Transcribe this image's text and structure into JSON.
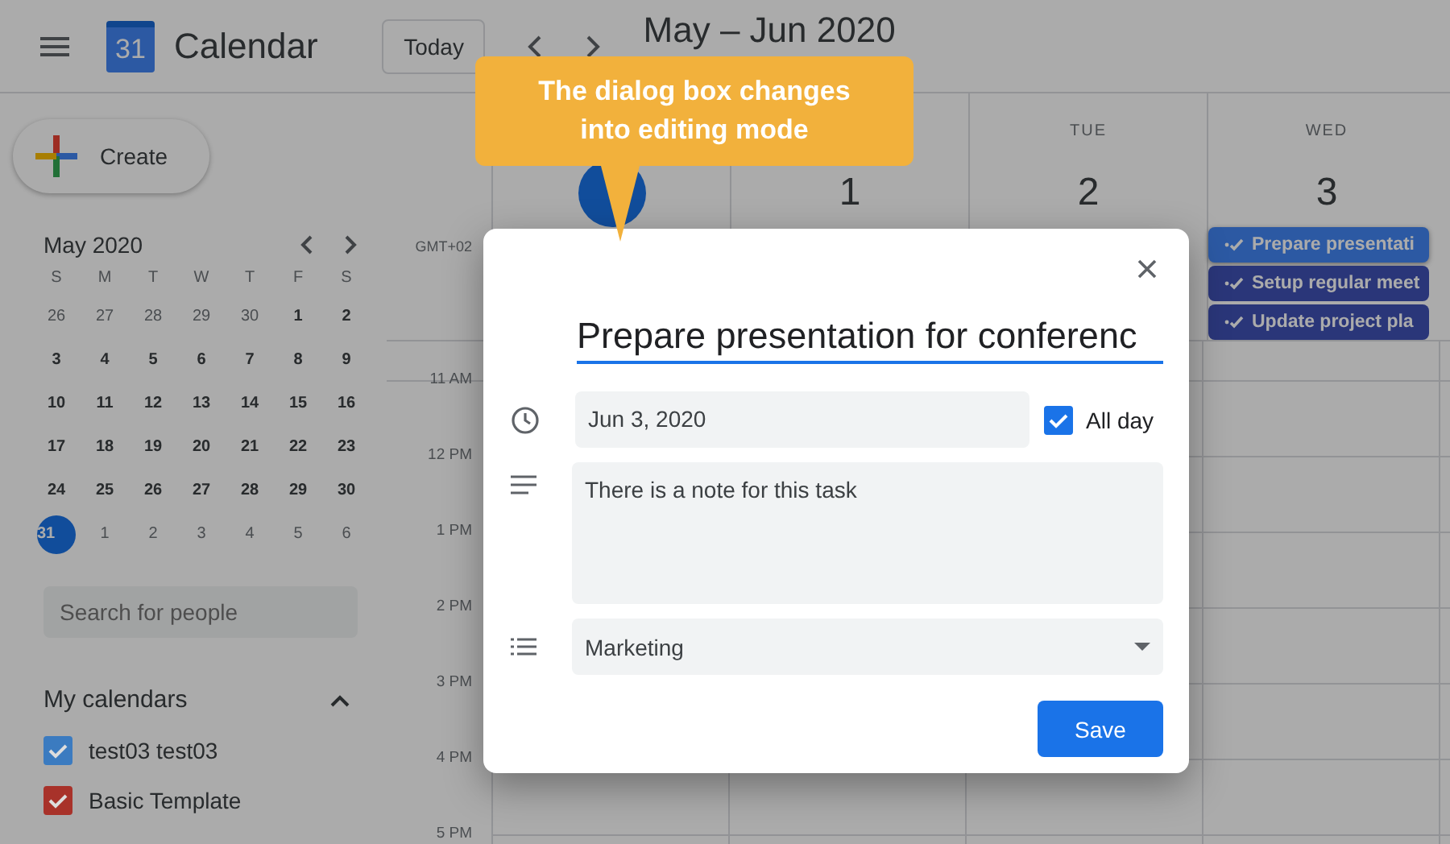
{
  "header": {
    "app_name": "Calendar",
    "logo_day": "31",
    "today_button": "Today",
    "range_title": "May – Jun 2020"
  },
  "sidebar": {
    "create_button": "Create",
    "mini_calendar": {
      "title": "May 2020",
      "weekdays": [
        "S",
        "M",
        "T",
        "W",
        "T",
        "F",
        "S"
      ],
      "weeks": [
        [
          {
            "d": "26",
            "other": true,
            "selected": false
          },
          {
            "d": "27",
            "other": true,
            "selected": false
          },
          {
            "d": "28",
            "other": true,
            "selected": false
          },
          {
            "d": "29",
            "other": true,
            "selected": false
          },
          {
            "d": "30",
            "other": true,
            "selected": false
          },
          {
            "d": "1",
            "other": false,
            "selected": false
          },
          {
            "d": "2",
            "other": false,
            "selected": false
          }
        ],
        [
          {
            "d": "3",
            "other": false,
            "selected": false
          },
          {
            "d": "4",
            "other": false,
            "selected": false
          },
          {
            "d": "5",
            "other": false,
            "selected": false
          },
          {
            "d": "6",
            "other": false,
            "selected": false
          },
          {
            "d": "7",
            "other": false,
            "selected": false
          },
          {
            "d": "8",
            "other": false,
            "selected": false
          },
          {
            "d": "9",
            "other": false,
            "selected": false
          }
        ],
        [
          {
            "d": "10",
            "other": false,
            "selected": false
          },
          {
            "d": "11",
            "other": false,
            "selected": false
          },
          {
            "d": "12",
            "other": false,
            "selected": false
          },
          {
            "d": "13",
            "other": false,
            "selected": false
          },
          {
            "d": "14",
            "other": false,
            "selected": false
          },
          {
            "d": "15",
            "other": false,
            "selected": false
          },
          {
            "d": "16",
            "other": false,
            "selected": false
          }
        ],
        [
          {
            "d": "17",
            "other": false,
            "selected": false
          },
          {
            "d": "18",
            "other": false,
            "selected": false
          },
          {
            "d": "19",
            "other": false,
            "selected": false
          },
          {
            "d": "20",
            "other": false,
            "selected": false
          },
          {
            "d": "21",
            "other": false,
            "selected": false
          },
          {
            "d": "22",
            "other": false,
            "selected": false
          },
          {
            "d": "23",
            "other": false,
            "selected": false
          }
        ],
        [
          {
            "d": "24",
            "other": false,
            "selected": false
          },
          {
            "d": "25",
            "other": false,
            "selected": false
          },
          {
            "d": "26",
            "other": false,
            "selected": false
          },
          {
            "d": "27",
            "other": false,
            "selected": false
          },
          {
            "d": "28",
            "other": false,
            "selected": false
          },
          {
            "d": "29",
            "other": false,
            "selected": false
          },
          {
            "d": "30",
            "other": false,
            "selected": false
          }
        ],
        [
          {
            "d": "31",
            "other": false,
            "selected": true
          },
          {
            "d": "1",
            "other": true,
            "selected": false
          },
          {
            "d": "2",
            "other": true,
            "selected": false
          },
          {
            "d": "3",
            "other": true,
            "selected": false
          },
          {
            "d": "4",
            "other": true,
            "selected": false
          },
          {
            "d": "5",
            "other": true,
            "selected": false
          },
          {
            "d": "6",
            "other": true,
            "selected": false
          }
        ]
      ]
    },
    "search": {
      "placeholder": "Search for people"
    },
    "my_calendars": {
      "title": "My calendars",
      "expanded": true,
      "items": [
        {
          "label": "test03 test03",
          "checked": true,
          "color": "#3b7bc0"
        },
        {
          "label": "Basic Template",
          "checked": true,
          "color": "#a8322a"
        }
      ]
    }
  },
  "week": {
    "timezone": "GMT+02",
    "days": [
      {
        "today": true
      },
      {
        "date": "1",
        "today": false
      },
      {
        "dow": "TUE",
        "date": "2",
        "today": false
      },
      {
        "dow": "WED",
        "date": "3",
        "today": false,
        "events": [
          {
            "title": "Prepare presentati",
            "selected": true
          },
          {
            "title": "Setup regular meet",
            "selected": false
          },
          {
            "title": "Update project pla",
            "selected": false
          }
        ]
      }
    ],
    "hours": [
      "11 AM",
      "12 PM",
      "1 PM",
      "2 PM",
      "3 PM",
      "4 PM",
      "5 PM"
    ]
  },
  "dialog": {
    "title": "Prepare presentation for conferenc",
    "date": "Jun 3, 2020",
    "all_day": {
      "label": "All day",
      "checked": true
    },
    "note": "There is a note for this task",
    "list": "Marketing",
    "save_button": "Save"
  },
  "callout": {
    "text": "The dialog box changes into editing mode"
  }
}
